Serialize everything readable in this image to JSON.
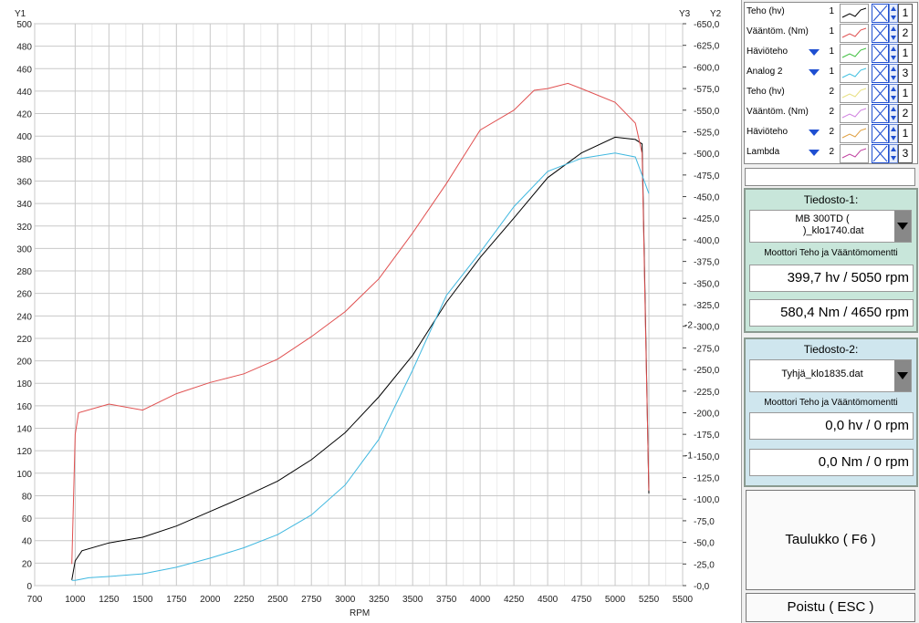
{
  "legend": {
    "items": [
      {
        "name": "Teho (hv)",
        "axis": "1",
        "color": "#000000",
        "dropdown": false,
        "box": "1"
      },
      {
        "name": "Vääntöm. (Nm)",
        "axis": "1",
        "color": "#e05050",
        "dropdown": false,
        "box": "2"
      },
      {
        "name": "Häviöteho",
        "axis": "1",
        "color": "#40c040",
        "dropdown": true,
        "box": "1"
      },
      {
        "name": "Analog 2",
        "axis": "1",
        "color": "#40c0e0",
        "dropdown": true,
        "box": "3"
      },
      {
        "name": "Teho (hv)",
        "axis": "2",
        "color": "#e8e080",
        "dropdown": false,
        "box": "1"
      },
      {
        "name": "Vääntöm. (Nm)",
        "axis": "2",
        "color": "#d080e0",
        "dropdown": false,
        "box": "2"
      },
      {
        "name": "Häviöteho",
        "axis": "2",
        "color": "#e0a040",
        "dropdown": true,
        "box": "1"
      },
      {
        "name": "Lambda",
        "axis": "2",
        "color": "#c040a0",
        "dropdown": true,
        "box": "3"
      }
    ]
  },
  "file1": {
    "title": "Tiedosto-1:",
    "selected": "MB 300TD (\n        )_klo1740.dat",
    "subtitle": "Moottori Teho ja Vääntömomentti",
    "power": "399,7 hv / 5050 rpm",
    "torque": "580,4 Nm / 4650 rpm"
  },
  "file2": {
    "title": "Tiedosto-2:",
    "selected": "Tyhjä_klo1835.dat",
    "subtitle": "Moottori Teho ja Vääntömomentti",
    "power": "0,0 hv / 0 rpm",
    "torque": "0,0 Nm / 0 rpm"
  },
  "buttons": {
    "table": "Taulukko ( F6 )",
    "exit": "Poistu ( ESC )"
  },
  "chart_data": {
    "type": "line",
    "xlabel": "RPM",
    "y1_label": "Y1",
    "y2_label": "Y2",
    "y3_label": "Y3",
    "xlim": [
      700,
      5500
    ],
    "x_ticks": [
      700,
      1000,
      1250,
      1500,
      1750,
      2000,
      2250,
      2500,
      2750,
      3000,
      3250,
      3500,
      3750,
      4000,
      4250,
      4500,
      4750,
      5000,
      5250,
      5500
    ],
    "y1_lim": [
      0,
      500
    ],
    "y1_ticks": [
      0,
      20,
      40,
      60,
      80,
      100,
      120,
      140,
      160,
      180,
      200,
      220,
      240,
      260,
      280,
      300,
      320,
      340,
      360,
      380,
      400,
      420,
      440,
      460,
      480,
      500
    ],
    "y2_lim": [
      0,
      650
    ],
    "y2_ticks": [
      "-0,0",
      "-25,0",
      "-50,0",
      "-75,0",
      "-100,0",
      "-125,0",
      "-150,0",
      "-175,0",
      "-200,0",
      "-225,0",
      "-250,0",
      "-275,0",
      "-300,0",
      "-325,0",
      "-350,0",
      "-375,0",
      "-400,0",
      "-425,0",
      "-450,0",
      "-475,0",
      "-500,0",
      "-525,0",
      "-550,0",
      "-575,0",
      "-600,0",
      "-625,0",
      "-650,0"
    ],
    "y3_tick_labels": [
      "-1",
      "-2"
    ],
    "grid": true,
    "series": [
      {
        "name": "Teho (hv)",
        "axis": "y1",
        "color": "#000000",
        "x": [
          975,
          1000,
          1050,
          1250,
          1500,
          1750,
          2000,
          2250,
          2500,
          2750,
          3000,
          3250,
          3500,
          3750,
          4000,
          4250,
          4500,
          4750,
          5000,
          5150,
          5200,
          5250
        ],
        "y": [
          5,
          22,
          31,
          38,
          43,
          53,
          66,
          79,
          93,
          112,
          136,
          168,
          205,
          252,
          292,
          327,
          363,
          385,
          399,
          397,
          393,
          82
        ]
      },
      {
        "name": "Vääntöm. (Nm)",
        "axis": "y2",
        "color": "#e05050",
        "x": [
          975,
          1000,
          1025,
          1250,
          1500,
          1750,
          2000,
          2250,
          2500,
          2750,
          3000,
          3250,
          3500,
          3750,
          4000,
          4250,
          4400,
          4500,
          4650,
          4750,
          5000,
          5150,
          5200,
          5225,
          5250
        ],
        "y": [
          25,
          175,
          200,
          210,
          203,
          222,
          235,
          245,
          262,
          288,
          317,
          355,
          408,
          465,
          527,
          550,
          573,
          575,
          581,
          575,
          559,
          535,
          500,
          300,
          110
        ]
      },
      {
        "name": "Analog 2",
        "axis": "y3",
        "color": "#40b8e0",
        "x": [
          975,
          1000,
          1100,
          1250,
          1500,
          1750,
          2000,
          2250,
          2500,
          2750,
          3000,
          3250,
          3500,
          3750,
          4000,
          4250,
          4500,
          4750,
          5000,
          5150,
          5250
        ],
        "y": [
          0.04,
          0.04,
          0.06,
          0.07,
          0.09,
          0.14,
          0.21,
          0.29,
          0.39,
          0.54,
          0.77,
          1.12,
          1.65,
          2.22,
          2.55,
          2.9,
          3.17,
          3.27,
          3.31,
          3.28,
          3.0
        ]
      }
    ]
  }
}
